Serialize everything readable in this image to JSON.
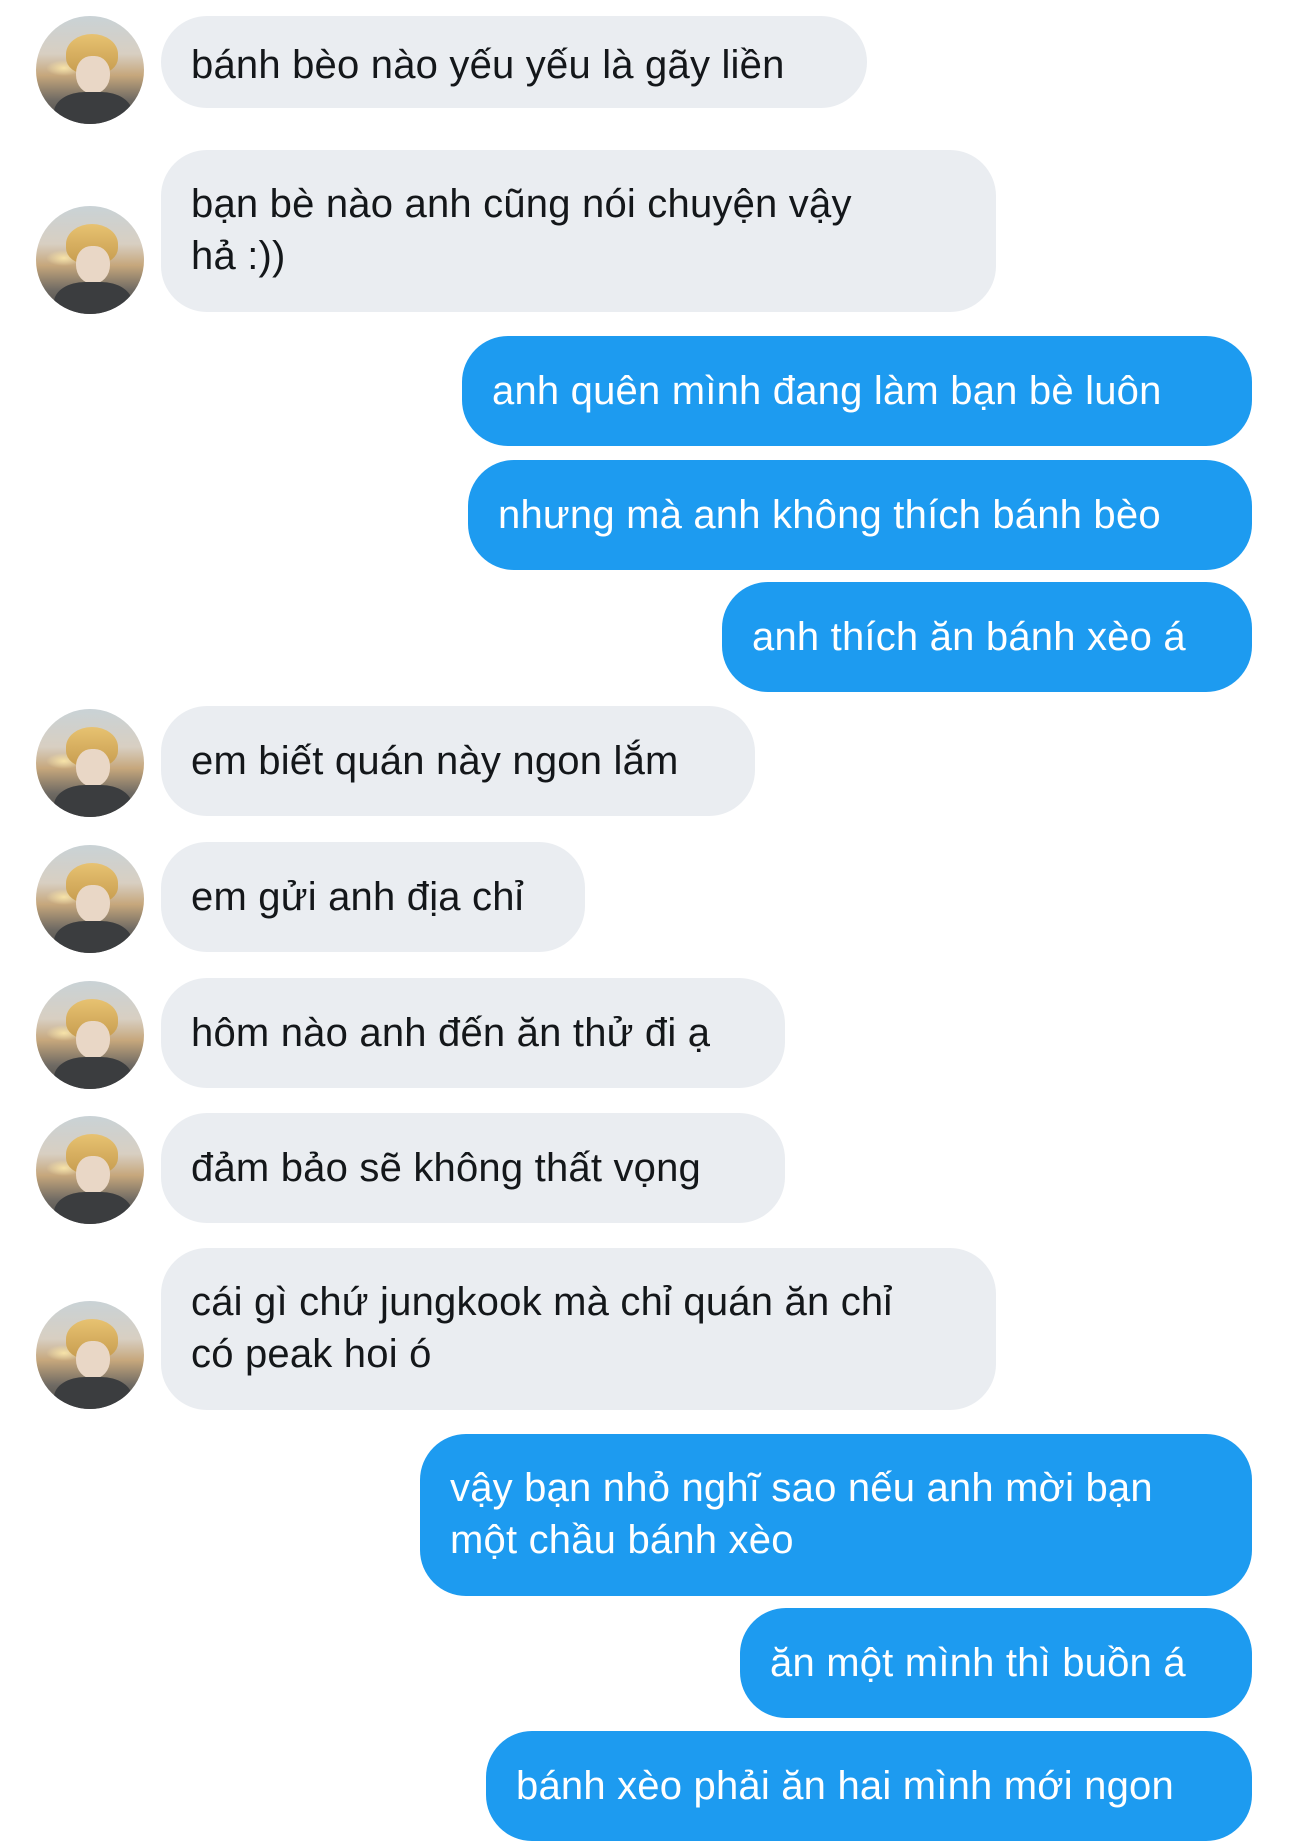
{
  "conversation": {
    "messages": [
      {
        "sender": "them",
        "text": "bánh bèo nào yếu yếu là gãy liền"
      },
      {
        "sender": "them",
        "text": "bạn bè nào anh cũng nói chuyện vậy\nhả :))"
      },
      {
        "sender": "me",
        "text": "anh quên mình đang làm bạn bè luôn"
      },
      {
        "sender": "me",
        "text": "nhưng mà anh không thích bánh bèo"
      },
      {
        "sender": "me",
        "text": "anh thích ăn bánh xèo á"
      },
      {
        "sender": "them",
        "text": "em biết quán này ngon lắm"
      },
      {
        "sender": "them",
        "text": "em gửi anh địa chỉ"
      },
      {
        "sender": "them",
        "text": "hôm nào anh đến ăn thử đi ạ"
      },
      {
        "sender": "them",
        "text": "đảm bảo sẽ không thất vọng"
      },
      {
        "sender": "them",
        "text": "cái gì chứ jungkook mà chỉ quán ăn chỉ\ncó peak hoi ó"
      },
      {
        "sender": "me",
        "text": "vậy bạn nhỏ nghĩ sao nếu anh mời bạn\nmột chầu bánh xèo"
      },
      {
        "sender": "me",
        "text": "ăn một mình thì buồn á"
      },
      {
        "sender": "me",
        "text": "bánh xèo phải ăn hai mình mới ngon"
      }
    ]
  },
  "colors": {
    "incoming_bubble": "#eaedf1",
    "outgoing_bubble": "#1d9bf0",
    "incoming_text": "#14171a",
    "outgoing_text": "#ffffff"
  },
  "icons": {
    "avatar": "contact-avatar-photo"
  }
}
